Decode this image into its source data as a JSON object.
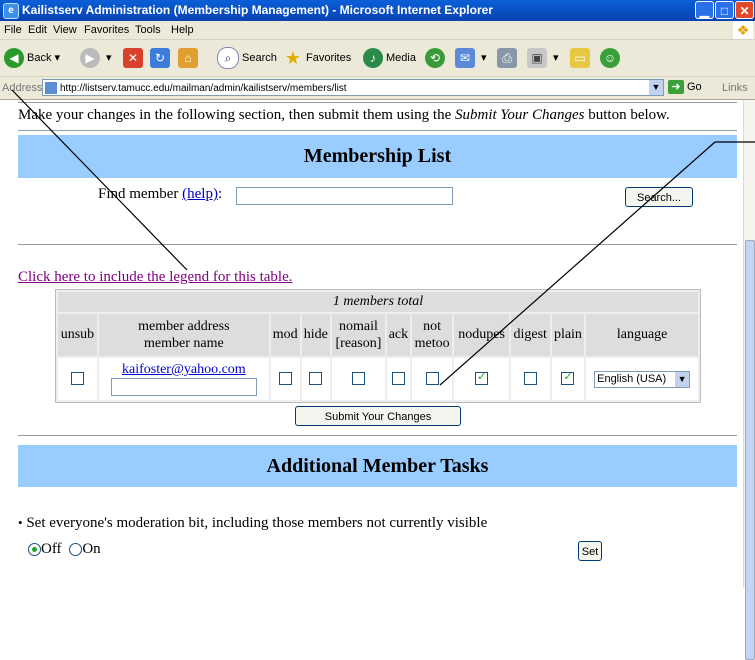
{
  "window": {
    "title": "Kailistserv Administration (Membership Management) - Microsoft Internet Explorer",
    "controls": {
      "minimize": "▁",
      "maximize": "□",
      "close": "✕"
    }
  },
  "menu": [
    "File",
    "Edit",
    "View",
    "Favorites",
    "Tools",
    "Help"
  ],
  "toolbar": {
    "back": "Back",
    "search": "Search",
    "favorites": "Favorites",
    "media": "Media"
  },
  "address": {
    "label": "Address",
    "url": "http://listserv.tamucc.edu/mailman/admin/kailistserv/members/list",
    "go": "Go",
    "links": "Links"
  },
  "page": {
    "intro_before": "Make your changes in the following section, then submit them using the ",
    "intro_emph": "Submit Your Changes",
    "intro_after": " button below.",
    "membership_heading": "Membership List",
    "find_label": "Find member ",
    "help_link": "(help)",
    "find_colon": ":",
    "find_value": "",
    "search_button": "Search...",
    "legend_link": "Click here to include the legend for this table.",
    "members_total": "1 members total",
    "columns": [
      "unsub",
      "member address",
      "member name",
      "mod",
      "hide",
      "nomail",
      "[reason]",
      "ack",
      "not",
      "metoo",
      "nodupes",
      "digest",
      "plain",
      "language"
    ],
    "member": {
      "email": "kaifoster@yahoo.com",
      "name": "",
      "unsub": false,
      "mod": false,
      "hide": false,
      "nomail": false,
      "ack": false,
      "not_metoo": false,
      "nodupes": true,
      "digest": false,
      "plain": true,
      "language": "English (USA)"
    },
    "submit_button": "Submit Your Changes",
    "tasks_heading": "Additional Member Tasks",
    "moderation_text": "Set everyone's moderation bit, including those members not currently visible",
    "radio_off": "Off",
    "radio_on": "On",
    "radio_selected": "Off",
    "set_button": "Set"
  }
}
